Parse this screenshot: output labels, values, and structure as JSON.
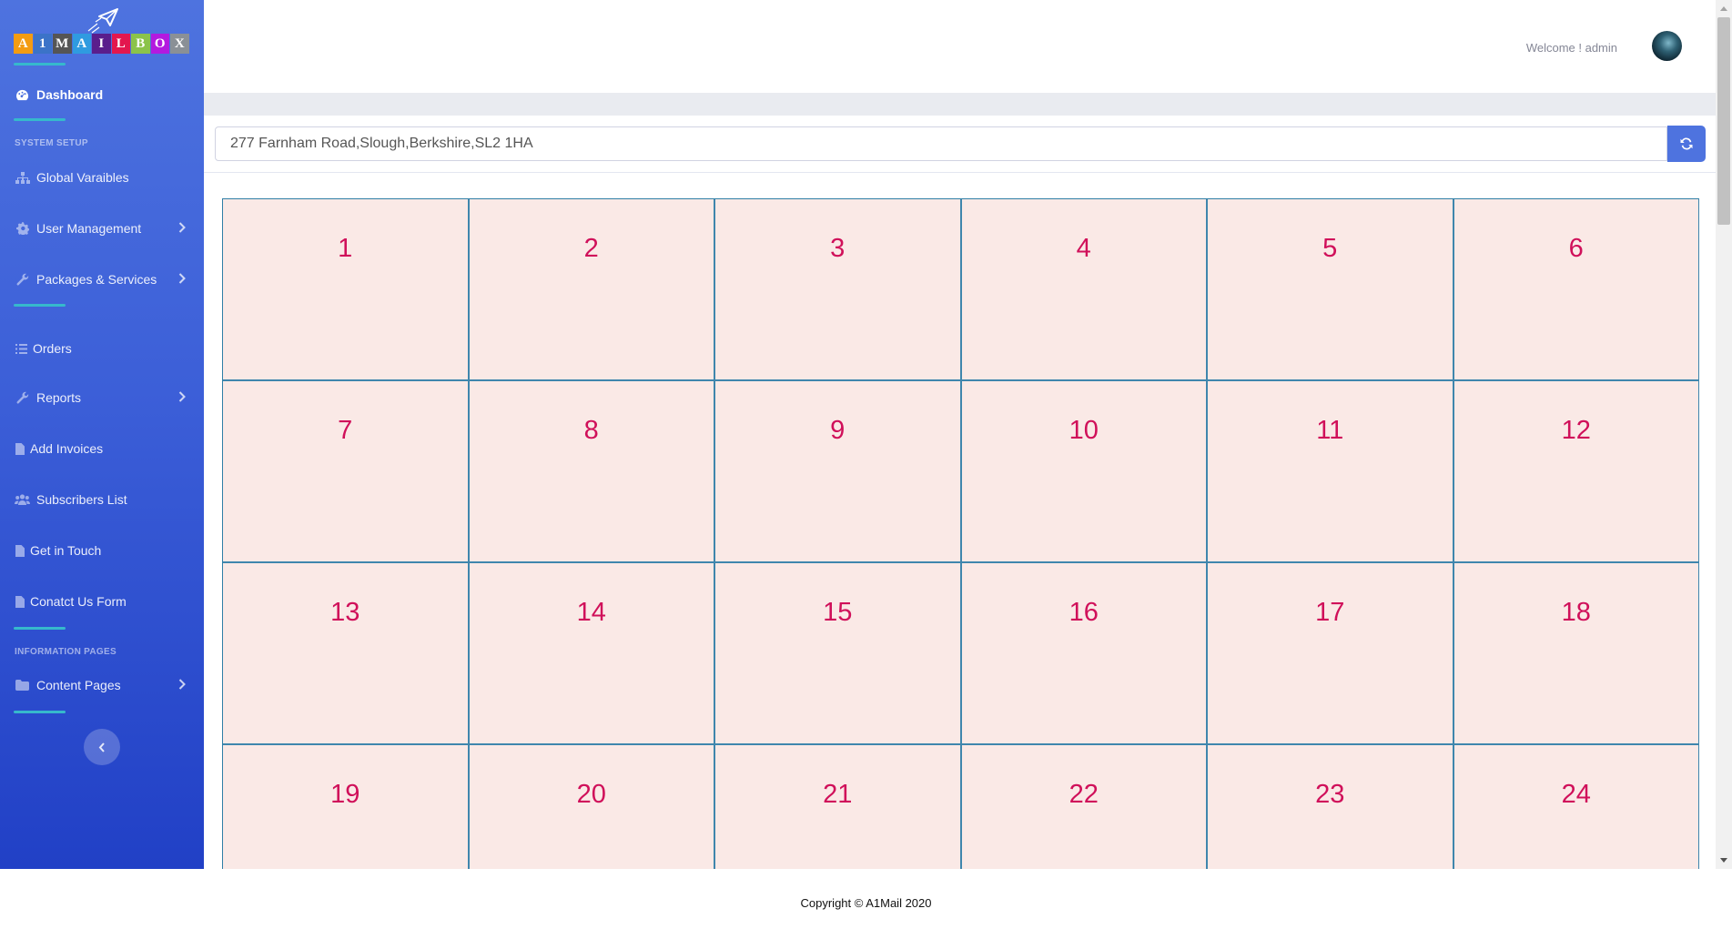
{
  "brand": {
    "letters": [
      "A",
      "1",
      "M",
      "A",
      "I",
      "L",
      "B",
      "O",
      "X"
    ],
    "colors": [
      "#f39c12",
      "#3b73c8",
      "#555555",
      "#2f9be0",
      "#5a1e8c",
      "#e3174e",
      "#8bc34a",
      "#b31adf",
      "#8a9096"
    ]
  },
  "sidebar": {
    "dashboard_label": "Dashboard",
    "section_system_setup": "System Setup",
    "section_information_pages": "Information Pages",
    "items": [
      {
        "label": "Global Varaibles",
        "icon": "sitemap-icon"
      },
      {
        "label": "User Management",
        "icon": "gear-icon"
      },
      {
        "label": "Packages & Services",
        "icon": "wrench-icon"
      },
      {
        "label": "Orders",
        "icon": "list-icon"
      },
      {
        "label": "Reports",
        "icon": "wrench-icon"
      },
      {
        "label": "Add Invoices",
        "icon": "file-icon"
      },
      {
        "label": "Subscribers List",
        "icon": "users-icon"
      },
      {
        "label": "Get in Touch",
        "icon": "file-icon"
      },
      {
        "label": "Conatct Us Form",
        "icon": "file-icon"
      },
      {
        "label": "Content Pages",
        "icon": "folder-icon"
      }
    ]
  },
  "topbar": {
    "welcome": "Welcome ! admin"
  },
  "address": {
    "value": "277 Farnham Road,Slough,Berkshire,SL2 1HA"
  },
  "grid": {
    "cells": [
      "1",
      "2",
      "3",
      "4",
      "5",
      "6",
      "7",
      "8",
      "9",
      "10",
      "11",
      "12",
      "13",
      "14",
      "15",
      "16",
      "17",
      "18",
      "19",
      "20",
      "21",
      "22",
      "23",
      "24"
    ]
  },
  "footer": {
    "copyright": "Copyright © A1Mail 2020"
  }
}
